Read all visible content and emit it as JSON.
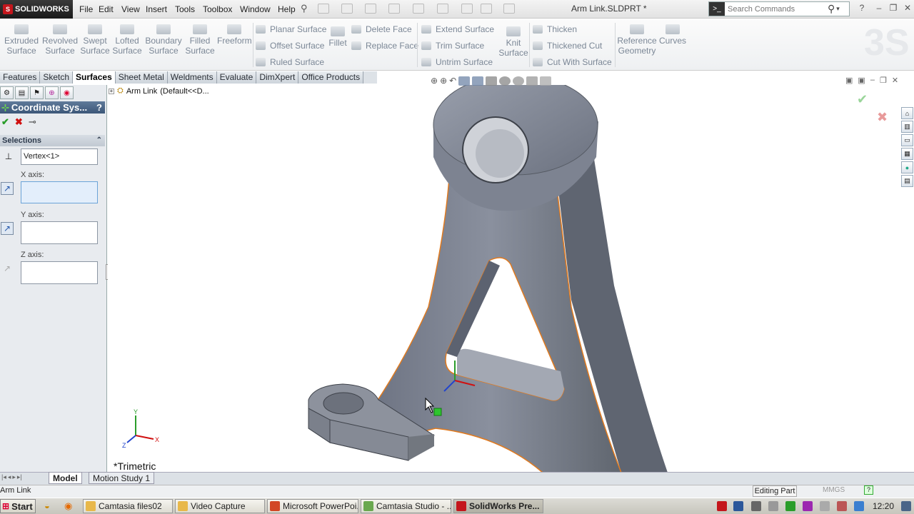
{
  "app": {
    "name": "SOLIDWORKS",
    "title": "Arm Link.SLDPRT *"
  },
  "menu": [
    "File",
    "Edit",
    "View",
    "Insert",
    "Tools",
    "Toolbox",
    "Window",
    "Help"
  ],
  "search": {
    "placeholder": "Search Commands"
  },
  "ribbon": {
    "big": [
      {
        "label": "Extruded\nSurface",
        "id": "extruded-surface"
      },
      {
        "label": "Revolved\nSurface",
        "id": "revolved-surface"
      },
      {
        "label": "Swept\nSurface",
        "id": "swept-surface"
      },
      {
        "label": "Lofted\nSurface",
        "id": "lofted-surface"
      },
      {
        "label": "Boundary\nSurface",
        "id": "boundary-surface"
      },
      {
        "label": "Filled\nSurface",
        "id": "filled-surface"
      },
      {
        "label": "Freeform",
        "id": "freeform"
      }
    ],
    "col1": [
      "Planar Surface",
      "Offset Surface",
      "Ruled Surface"
    ],
    "fillet": "Fillet",
    "col2": [
      "Delete Face",
      "Replace Face"
    ],
    "col3": [
      "Extend Surface",
      "Trim Surface",
      "Untrim Surface"
    ],
    "knit": "Knit\nSurface",
    "col4": [
      "Thicken",
      "Thickened Cut",
      "Cut With Surface"
    ],
    "reference_geometry": "Reference\nGeometry",
    "curves": "Curves"
  },
  "tabs": [
    "Features",
    "Sketch",
    "Surfaces",
    "Sheet Metal",
    "Weldments",
    "Evaluate",
    "DimXpert",
    "Office Products"
  ],
  "active_tab": "Surfaces",
  "property_manager": {
    "title": "Coordinate Sys...",
    "help": "?",
    "section": "Selections",
    "origin_value": "Vertex<1>",
    "x_label": "X axis:",
    "y_label": "Y axis:",
    "z_label": "Z axis:"
  },
  "tree": {
    "name": "Arm Link",
    "config": "(Default<<D..."
  },
  "view": {
    "orientation": "*Trimetric"
  },
  "bottom_tabs": [
    "Model",
    "Motion Study 1"
  ],
  "status": {
    "left": "Arm Link",
    "mode": "Editing Part",
    "units": "MMGS"
  },
  "taskbar": {
    "start": "Start",
    "items": [
      {
        "label": "Camtasia files02",
        "color": "#e8b84a"
      },
      {
        "label": "Video Capture",
        "color": "#e8b84a"
      },
      {
        "label": "Microsoft PowerPoi...",
        "color": "#d24726"
      },
      {
        "label": "Camtasia Studio - ...",
        "color": "#6aa84f"
      },
      {
        "label": "SolidWorks Pre...",
        "color": "#c4161c"
      }
    ],
    "clock": "12:20"
  },
  "colors": {
    "part": "#7d8391",
    "edge_highlight": "#e07a1f",
    "header": "#4a6588"
  }
}
